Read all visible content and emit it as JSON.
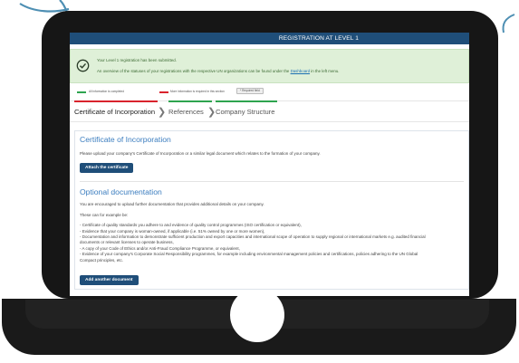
{
  "header": {
    "title": "REGISTRATION AT LEVEL 1"
  },
  "alert": {
    "line1": "Your Level 1 registration has been submitted.",
    "line2_prefix": "An overview of the statuses of your registrations with the respective UN organizations can be found under the ",
    "link": "Dashboard",
    "line2_suffix": " in the left menu.",
    "color": "#dff0d8"
  },
  "legend": {
    "complete": "All information is completed",
    "more": "More information is required in this section",
    "required": "* Required field",
    "complete_color": "#2ea44f",
    "more_color": "#d9232d"
  },
  "tabs": [
    {
      "label": "Certificate of Incorporation",
      "status_color": "#d9232d"
    },
    {
      "label": "References",
      "status_color": "#2ea44f"
    },
    {
      "label": "Company Structure",
      "status_color": "#2ea44f"
    }
  ],
  "cert": {
    "title": "Certificate of Incorporation",
    "description": "Please upload your company's Certificate of Incorporation or a similar legal document which relates to the formation of your company.",
    "button": "Attach the certificate"
  },
  "optional": {
    "title": "Optional documentation",
    "intro": "You are encouraged to upload further documentation that provides additional details on your company.",
    "examples_label": "These can for example be:",
    "items": [
      "- Certificate of quality standards you adhere to and evidence of quality control programmes (ISO certification or equivalent),",
      "- Evidence that your company is woman-owned, if applicable (i.e. 51% owned by one or more women),",
      "- Documentation and information to demonstrate sufficient production and export capacities and international scope of operation to supply regional or international markets e.g. audited financial",
      "documents or relevant licenses to operate business,",
      "- A copy of your Code of Ethics and/or Anti-Fraud Compliance Programme, or equivalent,",
      "- Evidence of your company's Corporate Social Responsibility programmes, for example including environmental management policies and certifications, policies adhering to the UN Global",
      "Compact principles, etc."
    ],
    "button": "Add another document"
  }
}
